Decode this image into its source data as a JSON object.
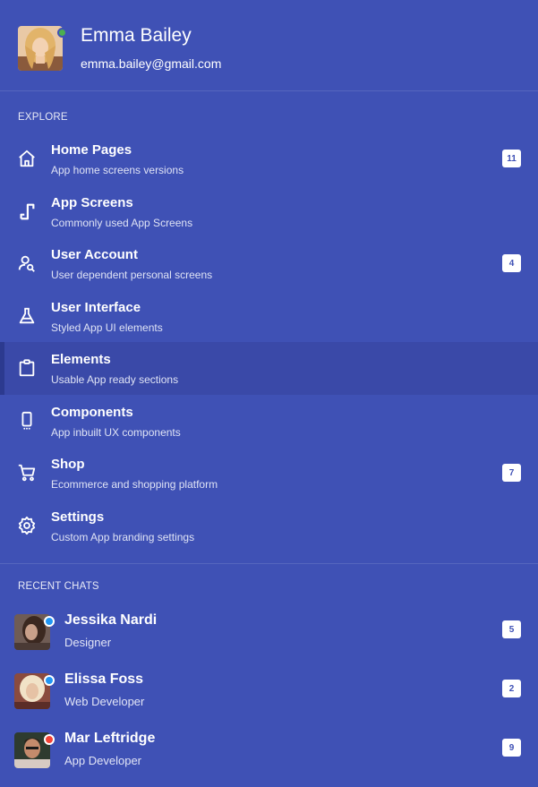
{
  "profile": {
    "name": "Emma Bailey",
    "email": "emma.bailey@gmail.com",
    "status_color": "#4caf50"
  },
  "explore": {
    "label": "EXPLORE",
    "items": [
      {
        "icon": "home-icon",
        "title": "Home Pages",
        "subtitle": "App home screens versions",
        "badge": "11",
        "active": false
      },
      {
        "icon": "app-screens-icon",
        "title": "App Screens",
        "subtitle": "Commonly used App Screens",
        "badge": "",
        "active": false
      },
      {
        "icon": "user-search-icon",
        "title": "User Account",
        "subtitle": "User dependent personal screens",
        "badge": "4",
        "active": false
      },
      {
        "icon": "flask-icon",
        "title": "User Interface",
        "subtitle": "Styled App UI elements",
        "badge": "",
        "active": false
      },
      {
        "icon": "clipboard-icon",
        "title": "Elements",
        "subtitle": "Usable App ready sections",
        "badge": "",
        "active": true
      },
      {
        "icon": "mobile-icon",
        "title": "Components",
        "subtitle": "App inbuilt UX components",
        "badge": "",
        "active": false
      },
      {
        "icon": "cart-icon",
        "title": "Shop",
        "subtitle": "Ecommerce and shopping platform",
        "badge": "7",
        "active": false
      },
      {
        "icon": "gear-icon",
        "title": "Settings",
        "subtitle": "Custom App branding settings",
        "badge": "",
        "active": false
      }
    ]
  },
  "recent_chats": {
    "label": "RECENT CHATS",
    "items": [
      {
        "name": "Jessika Nardi",
        "role": "Designer",
        "badge": "5",
        "status_color": "#2196f3"
      },
      {
        "name": "Elissa Foss",
        "role": "Web Developer",
        "badge": "2",
        "status_color": "#2196f3"
      },
      {
        "name": "Mar Leftridge",
        "role": "App Developer",
        "badge": "9",
        "status_color": "#f44336"
      }
    ]
  },
  "colors": {
    "background": "#3f51b5",
    "active_row": "#3a49a8",
    "badge_bg": "#ffffff",
    "badge_text": "#3f51b5"
  }
}
